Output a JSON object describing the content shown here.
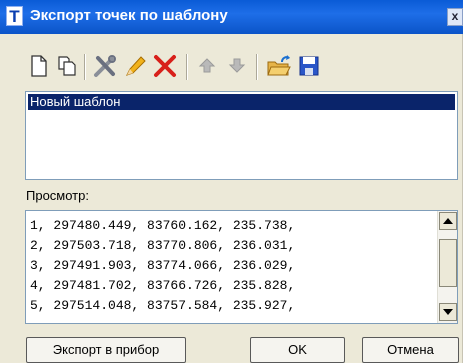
{
  "window": {
    "title": "Экспорт точек по шаблону",
    "app_icon_letter": "T",
    "close_glyph": "x"
  },
  "toolbar": {
    "icons": [
      "new-document-icon",
      "copy-icon",
      "tools-icon",
      "pencil-icon",
      "delete-icon",
      "arrow-up-icon",
      "arrow-down-icon",
      "open-folder-icon",
      "save-icon"
    ]
  },
  "templates": {
    "items": [
      "Новый шаблон"
    ],
    "selected_index": 0
  },
  "preview": {
    "label": "Просмотр:",
    "lines": [
      "1, 297480.449, 83760.162, 235.738,",
      "2, 297503.718, 83770.806, 236.031,",
      "3, 297491.903, 83774.066, 236.029,",
      "4, 297481.702, 83766.726, 235.828,",
      "5, 297514.048, 83757.584, 235.927,"
    ]
  },
  "buttons": {
    "export_device": "Экспорт в прибор",
    "ok": "OK",
    "cancel": "Отмена"
  },
  "colors": {
    "title_bar": "#0a5bd6",
    "selection": "#0a246a",
    "window_bg": "#ece9d8"
  }
}
